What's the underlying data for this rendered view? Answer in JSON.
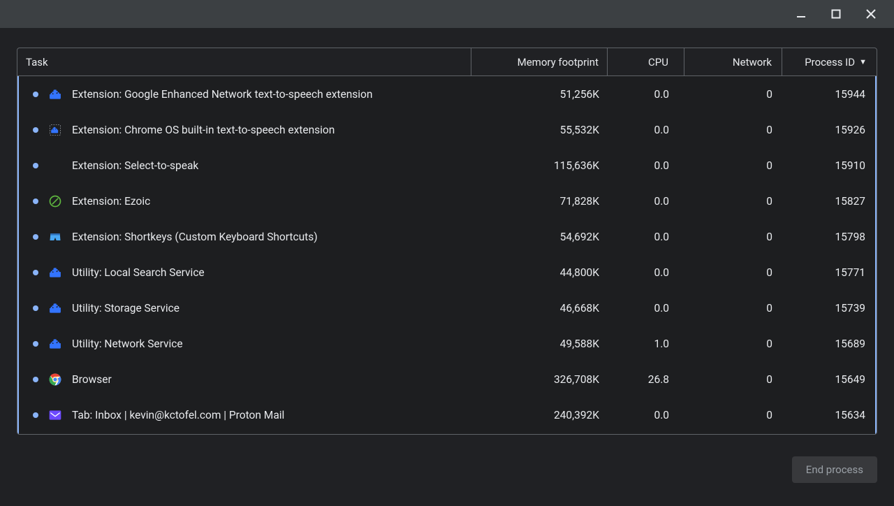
{
  "columns": {
    "task": "Task",
    "memory": "Memory footprint",
    "cpu": "CPU",
    "network": "Network",
    "pid": "Process ID",
    "sort_indicator": "▼"
  },
  "rows": [
    {
      "icon": "puzzle-blue",
      "name": "Extension: Google Enhanced Network text-to-speech extension",
      "memory": "51,256K",
      "cpu": "0.0",
      "network": "0",
      "pid": "15944"
    },
    {
      "icon": "puzzle-dotted",
      "name": "Extension: Chrome OS built-in text-to-speech extension",
      "memory": "55,532K",
      "cpu": "0.0",
      "network": "0",
      "pid": "15926"
    },
    {
      "icon": "none",
      "name": "Extension: Select-to-speak",
      "memory": "115,636K",
      "cpu": "0.0",
      "network": "0",
      "pid": "15910"
    },
    {
      "icon": "ezoic",
      "name": "Extension: Ezoic",
      "memory": "71,828K",
      "cpu": "0.0",
      "network": "0",
      "pid": "15827"
    },
    {
      "icon": "shorts",
      "name": "Extension: Shortkeys (Custom Keyboard Shortcuts)",
      "memory": "54,692K",
      "cpu": "0.0",
      "network": "0",
      "pid": "15798"
    },
    {
      "icon": "puzzle-blue",
      "name": "Utility: Local Search Service",
      "memory": "44,800K",
      "cpu": "0.0",
      "network": "0",
      "pid": "15771"
    },
    {
      "icon": "puzzle-blue",
      "name": "Utility: Storage Service",
      "memory": "46,668K",
      "cpu": "0.0",
      "network": "0",
      "pid": "15739"
    },
    {
      "icon": "puzzle-blue",
      "name": "Utility: Network Service",
      "memory": "49,588K",
      "cpu": "1.0",
      "network": "0",
      "pid": "15689"
    },
    {
      "icon": "chrome",
      "name": "Browser",
      "memory": "326,708K",
      "cpu": "26.8",
      "network": "0",
      "pid": "15649"
    },
    {
      "icon": "proton",
      "name": "Tab: Inbox | kevin@kctofel.com | Proton Mail",
      "memory": "240,392K",
      "cpu": "0.0",
      "network": "0",
      "pid": "15634"
    }
  ],
  "footer": {
    "end_process": "End process"
  }
}
